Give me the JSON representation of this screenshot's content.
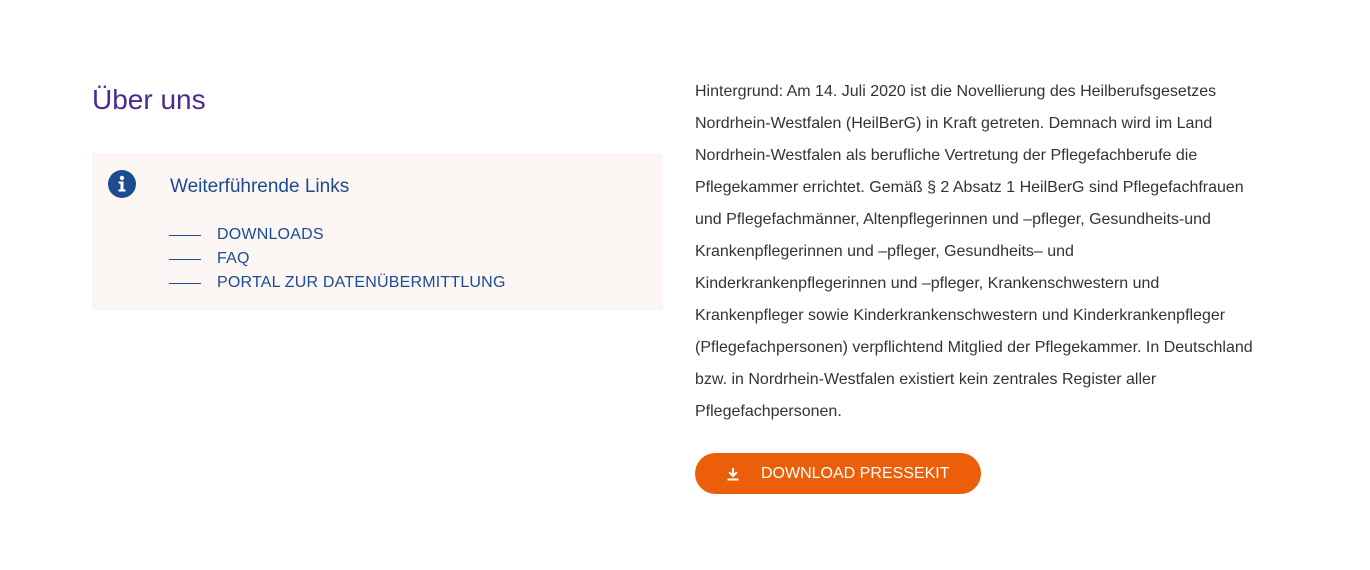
{
  "page": {
    "title": "Über uns"
  },
  "links_box": {
    "icon": "info-icon",
    "title": "Weiterführende Links",
    "links": [
      {
        "label": "DOWNLOADS"
      },
      {
        "label": "FAQ"
      },
      {
        "label": "PORTAL ZUR DATENÜBERMITTLUNG"
      }
    ]
  },
  "content": {
    "paragraph": "Hintergrund: Am 14. Juli 2020 ist die Novellierung des Heilberufsgesetzes Nordrhein-Westfalen (HeilBerG) in Kraft getreten. Demnach wird im Land Nordrhein-Westfalen als berufliche Vertretung der Pflegefachberufe die Pflegekammer errichtet. Gemäß § 2 Absatz 1 HeilBerG sind Pflegefachfrauen und Pflegefachmänner, Altenpflegerinnen und –pfleger, Gesundheits-und Krankenpflegerinnen und –pfleger, Gesundheits– und Kinderkrankenpflegerinnen und –pfleger, Krankenschwestern und Krankenpfleger sowie Kinderkrankenschwestern und Kinderkrankenpfleger (Pflegefachpersonen) verpflichtend Mitglied der Pflegekammer. In Deutschland bzw. in Nordrhein-Westfalen existiert kein zentrales Register aller Pflegefachpersonen."
  },
  "download": {
    "icon": "download-icon",
    "label": "DOWNLOAD PRESSEKIT"
  },
  "colors": {
    "title_purple": "#4b2b8f",
    "link_blue": "#1c4b8f",
    "box_background": "#fbf6f3",
    "button_orange": "#ed5e0a"
  }
}
